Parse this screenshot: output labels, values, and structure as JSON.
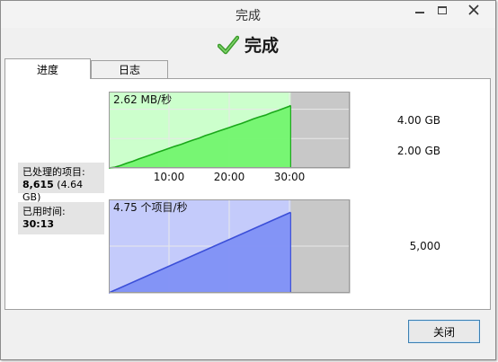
{
  "window": {
    "title": "完成"
  },
  "header": {
    "title": "完成",
    "icon": "checkmark-icon"
  },
  "tabs": [
    {
      "label": "进度",
      "active": true
    },
    {
      "label": "日志",
      "active": false
    }
  ],
  "stats": {
    "processed": {
      "label": "已处理的项目:",
      "count": "8,615",
      "size": "(4.64 GB)"
    },
    "elapsed": {
      "label": "已用时间:",
      "value": "30:13"
    }
  },
  "colors": {
    "throughput_fill": "#72f56e",
    "throughput_bg": "#ccffcc",
    "throughput_line": "#1aa81a",
    "items_fill": "#7f90f6",
    "items_bg": "#c4cbfb",
    "items_line": "#3b4fd8",
    "remaining_bg": "#c8c8c8",
    "grid": "#e8e8e8"
  },
  "chart_data": [
    {
      "type": "area",
      "title": "2.62 MB/秒",
      "x_tick_labels": [
        "10:00",
        "20:00",
        "30:00"
      ],
      "x_ticks": [
        10,
        20,
        30
      ],
      "y_tick_labels": [
        "4.00 GB",
        "2.00 GB"
      ],
      "y_ticks": [
        4.0,
        2.0
      ],
      "xlim": [
        0,
        40
      ],
      "ylim": [
        0,
        5.2
      ],
      "x_end": 30.2,
      "series": [
        {
          "x": [
            0,
            1,
            2,
            3,
            4,
            5,
            6,
            7,
            8,
            9,
            10,
            11,
            12,
            13,
            14,
            15,
            16,
            17,
            18,
            19,
            20,
            21,
            22,
            23,
            24,
            25,
            26,
            27,
            28,
            29,
            30,
            30.2
          ],
          "values": [
            0,
            0.05,
            0.18,
            0.33,
            0.46,
            0.62,
            0.76,
            0.9,
            1.05,
            1.19,
            1.34,
            1.48,
            1.6,
            1.76,
            1.9,
            2.03,
            2.2,
            2.33,
            2.48,
            2.62,
            2.75,
            2.9,
            3.03,
            3.18,
            3.34,
            3.48,
            3.6,
            3.76,
            3.9,
            4.05,
            4.2,
            4.26
          ]
        }
      ]
    },
    {
      "type": "area",
      "title": "4.75 个项目/秒",
      "y_tick_labels": [
        "5,000"
      ],
      "y_ticks": [
        5000
      ],
      "xlim": [
        0,
        40
      ],
      "ylim": [
        0,
        10000
      ],
      "x_end": 30.2,
      "series": [
        {
          "x": [
            0,
            30.2
          ],
          "values": [
            0,
            8615
          ]
        }
      ]
    }
  ],
  "footer": {
    "close_label": "关闭"
  }
}
